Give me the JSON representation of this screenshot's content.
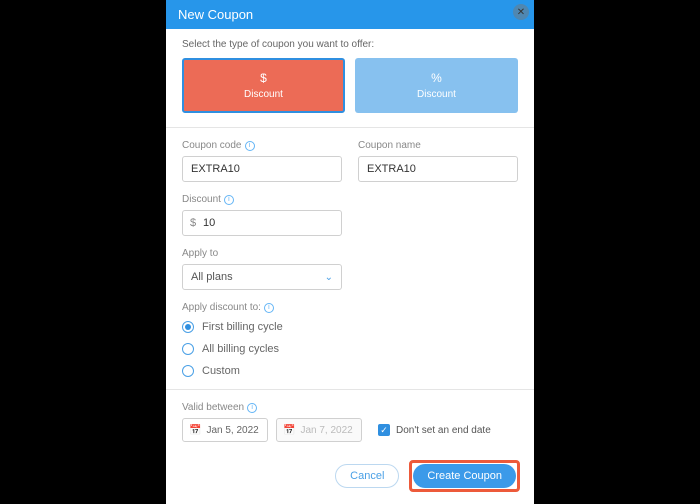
{
  "header": {
    "title": "New Coupon"
  },
  "intro": "Select the type of coupon you want to offer:",
  "types": {
    "dollar": {
      "symbol": "$",
      "label": "Discount"
    },
    "percent": {
      "symbol": "%",
      "label": "Discount"
    }
  },
  "fields": {
    "coupon_code_label": "Coupon code",
    "coupon_code_value": "EXTRA10",
    "coupon_name_label": "Coupon name",
    "coupon_name_value": "EXTRA10",
    "discount_label": "Discount",
    "discount_prefix": "$",
    "discount_value": "10",
    "apply_to_label": "Apply to",
    "apply_to_value": "All plans",
    "apply_discount_label": "Apply discount to:",
    "radio_first": "First billing cycle",
    "radio_all": "All billing cycles",
    "radio_custom": "Custom",
    "valid_label": "Valid between",
    "date_start": "Jan 5, 2022",
    "date_end": "Jan 7, 2022",
    "no_end_date": "Don't set an end date"
  },
  "buttons": {
    "cancel": "Cancel",
    "create": "Create Coupon"
  }
}
